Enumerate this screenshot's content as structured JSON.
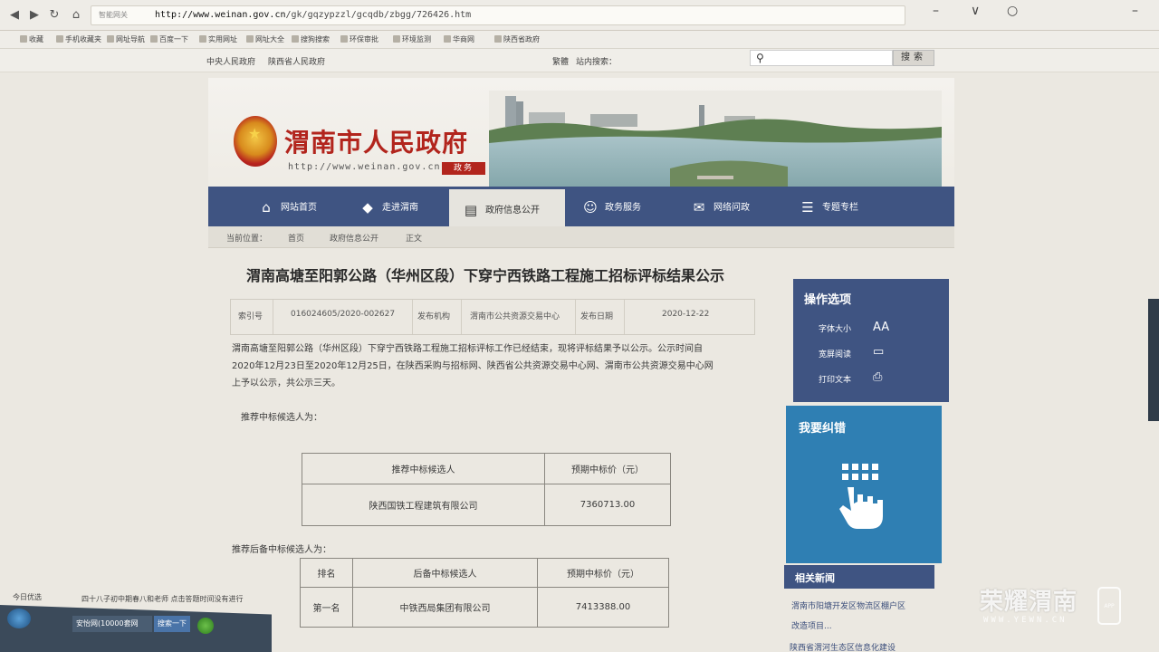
{
  "browser": {
    "url_host": "http://www.weinan.gov.cn",
    "url_path": "/gk/gqzypzzl/gcqdb/zbgg/726426.htm",
    "lock_text": "智能网关",
    "favorites": [
      "收藏",
      "手机收藏夹",
      "网址导航",
      "百度一下",
      "实用网址",
      "网址大全",
      "搜狗搜索",
      "环保审批",
      "环境监测",
      "华商网",
      "陕西省政府"
    ]
  },
  "topstrip": {
    "links": [
      "中央人民政府",
      "陕西省人民政府"
    ],
    "traditional": "繁體",
    "search_label": "站内搜索：",
    "search_button": "搜索"
  },
  "header": {
    "title": "渭南市人民政府",
    "url": "http://www.weinan.gov.cn",
    "badge": "政务"
  },
  "nav": {
    "items": [
      {
        "label": "网站首页",
        "icon": "home-icon"
      },
      {
        "label": "走进渭南",
        "icon": "map-icon"
      },
      {
        "label": "政府信息公开",
        "icon": "document-icon"
      },
      {
        "label": "政务服务",
        "icon": "service-icon"
      },
      {
        "label": "网络问政",
        "icon": "chat-icon"
      },
      {
        "label": "专题专栏",
        "icon": "list-icon"
      }
    ]
  },
  "breadcrumb": {
    "label": "当前位置：",
    "items": [
      "首页",
      "政府信息公开",
      "正文"
    ]
  },
  "article": {
    "title": "渭南高塘至阳郭公路（华州区段）下穿宁西铁路工程施工招标评标结果公示",
    "meta": {
      "index_label": "索引号",
      "index_value": "016024605/2020-002627",
      "org_label": "发布机构",
      "org_value": "渭南市公共资源交易中心",
      "date_label": "发布日期",
      "date_value": "2020-12-22"
    },
    "para_lines": [
      "渭南高塘至阳郭公路（华州区段）下穿宁西铁路工程施工招标评标工作已经结束，现将评标结果予以公示。公示时间自",
      "2020年12月23日至2020年12月25日，在陕西采购与招标网、陕西省公共资源交易中心网、渭南市公共资源交易中心网",
      "上予以公示，共公示三天。"
    ],
    "recommend_label": "推荐中标候选人为：",
    "table1": {
      "headers": [
        "推荐中标候选人",
        "预期中标价（元）"
      ],
      "row": [
        "陕西国铁工程建筑有限公司",
        "7360713.00"
      ]
    },
    "backup_label": "推荐后备中标候选人为：",
    "table2": {
      "headers": [
        "排名",
        "后备中标候选人",
        "预期中标价（元）"
      ],
      "row": [
        "第一名",
        "中铁西局集团有限公司",
        "7413388.00"
      ]
    }
  },
  "sidebar": {
    "ops_title": "操作选项",
    "ops": [
      {
        "label": "字体大小",
        "icon": "font-size-icon",
        "glyph": "AA"
      },
      {
        "label": "宽屏阅读",
        "icon": "monitor-icon",
        "glyph": "▭"
      },
      {
        "label": "打印文本",
        "icon": "printer-icon",
        "glyph": "⎙"
      }
    ],
    "error_title": "我要纠错",
    "news_title": "相关新闻",
    "news_items": [
      "渭南市阳塘开发区物流区棚户区",
      "改造项目...",
      "陕西省渭河生态区信息化建设"
    ]
  },
  "statusbar": {
    "left": "今日优选",
    "mid": "四十八子初中期春八和老师  点击答题时间没有进行"
  },
  "taskbar": {
    "items": [
      "安怡网(10000套网",
      "搜索一下"
    ]
  },
  "watermark": {
    "main": "荣耀渭南",
    "sub": "WWW.YEWN.CN",
    "app": "APP"
  }
}
